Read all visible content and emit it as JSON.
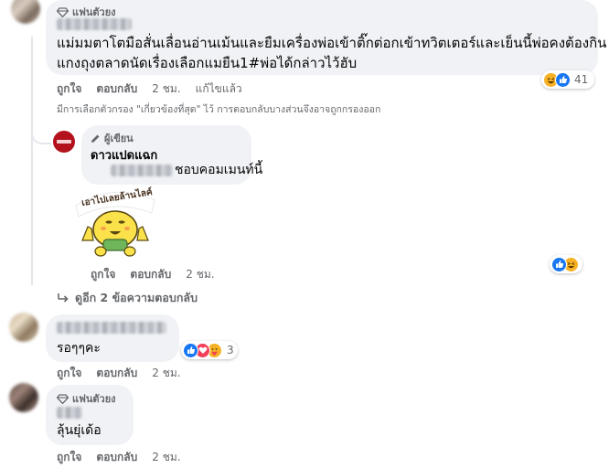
{
  "comment1": {
    "badge": "แฟนตัวยง",
    "line1": "แม่มมตาโตมือสั่นเลื่อนอ่านเม้นและยืมเครื่องพ่อเข้าติ๊กต่อกเข้าทวิตเตอร์และเย็นนี้พ่อคงต้องกิน",
    "line2": "แกงถุงตลาดนัดเรื่องเลือกแมยืน1#พ่อได้กล่าวไว้ฮับ",
    "reactions": {
      "count": "41",
      "icons": [
        "haha",
        "like"
      ]
    },
    "actions": {
      "like": "ถูกใจ",
      "reply": "ตอบกลับ",
      "time": "2 ชม.",
      "edited": "แก้ไขแล้ว"
    }
  },
  "filter_notice": "มีการเลือกตัวกรอง \"เกี่ยวข้องที่สุด\" ไว้ การตอบกลับบางส่วนจึงอาจถูกกรองออก",
  "reply1": {
    "badge": "ผู้เขียน",
    "author": "ดาวแปดแฉก",
    "text": "ชอบคอมเมนท์นี้",
    "sticker_text": "เอาไปเลยล้านไลค์",
    "reactions": {
      "icons": [
        "like",
        "haha"
      ]
    },
    "actions": {
      "like": "ถูกใจ",
      "reply": "ตอบกลับ",
      "time": "2 ชม."
    }
  },
  "more_replies": "ดูอีก 2 ข้อความตอบกลับ",
  "comment2": {
    "text": "รอๆๆคะ",
    "reactions": {
      "count": "3",
      "icons": [
        "like",
        "love",
        "care"
      ]
    },
    "actions": {
      "like": "ถูกใจ",
      "reply": "ตอบกลับ",
      "time": "2 ชม."
    }
  },
  "comment3": {
    "badge": "แฟนตัวยง",
    "text": "ลุ้นยุ่เด้อ",
    "actions": {
      "like": "ถูกใจ",
      "reply": "ตอบกลับ",
      "time": "2 ชม."
    }
  },
  "colors": {
    "link_blue": "#1877f2",
    "bubble": "#f0f2f5",
    "secondary_text": "#65676b",
    "author_avatar": "#b3121d"
  }
}
